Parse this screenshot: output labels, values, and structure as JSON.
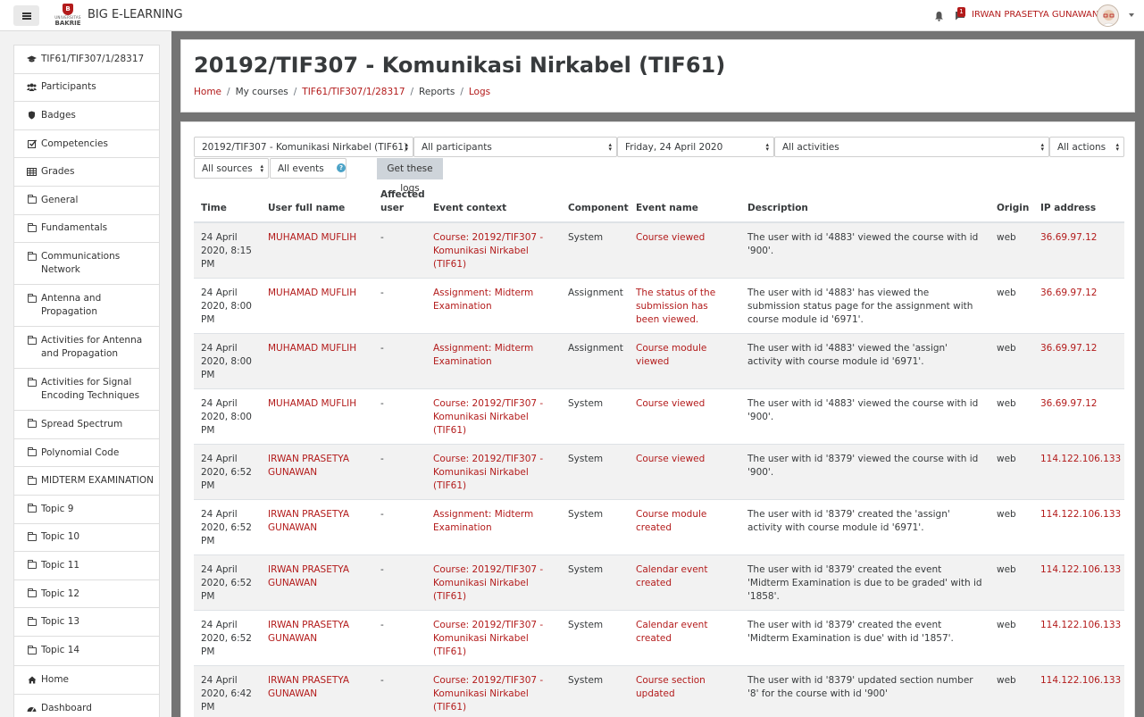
{
  "navbar": {
    "site_name": "BIG E-LEARNING",
    "logo_top": "UNIVERSITAS",
    "logo_bottom": "BAKRIE",
    "logo_mark": "B",
    "user_name": "IRWAN PRASETYA GUNAWAN",
    "message_count": "1"
  },
  "sidebar": {
    "course_items": [
      {
        "label": "TIF61/TIF307/1/28317",
        "icon": "graduation-cap-icon"
      },
      {
        "label": "Participants",
        "icon": "users-icon"
      },
      {
        "label": "Badges",
        "icon": "shield-icon"
      },
      {
        "label": "Competencies",
        "icon": "check-square-icon"
      },
      {
        "label": "Grades",
        "icon": "table-icon"
      },
      {
        "label": "General",
        "icon": "folder-icon"
      },
      {
        "label": "Fundamentals",
        "icon": "folder-icon"
      },
      {
        "label": "Communications Network",
        "icon": "folder-icon"
      },
      {
        "label": "Antenna and Propagation",
        "icon": "folder-icon"
      },
      {
        "label": "Activities for Antenna and Propagation",
        "icon": "folder-icon"
      },
      {
        "label": "Activities for Signal Encoding Techniques",
        "icon": "folder-icon"
      },
      {
        "label": "Spread Spectrum",
        "icon": "folder-icon"
      },
      {
        "label": "Polynomial Code",
        "icon": "folder-icon"
      },
      {
        "label": "MIDTERM EXAMINATION",
        "icon": "folder-icon"
      },
      {
        "label": "Topic 9",
        "icon": "folder-icon"
      },
      {
        "label": "Topic 10",
        "icon": "folder-icon"
      },
      {
        "label": "Topic 11",
        "icon": "folder-icon"
      },
      {
        "label": "Topic 12",
        "icon": "folder-icon"
      },
      {
        "label": "Topic 13",
        "icon": "folder-icon"
      },
      {
        "label": "Topic 14",
        "icon": "folder-icon"
      }
    ],
    "site_items": [
      {
        "label": "Home",
        "icon": "home-icon"
      },
      {
        "label": "Dashboard",
        "icon": "dashboard-icon"
      }
    ]
  },
  "header": {
    "title": "20192/TIF307 - Komunikasi Nirkabel (TIF61)",
    "breadcrumb": [
      "Home",
      "My courses",
      "TIF61/TIF307/1/28317",
      "Reports",
      "Logs"
    ]
  },
  "filters": {
    "course": "20192/TIF307 - Komunikasi Nirkabel (TIF61)",
    "participants": "All participants",
    "date": "Friday, 24 April 2020",
    "activities": "All activities",
    "actions": "All actions",
    "sources": "All sources",
    "events": "All events",
    "help": "?",
    "button": "Get these logs"
  },
  "table": {
    "headers": [
      "Time",
      "User full name",
      "Affected user",
      "Event context",
      "Component",
      "Event name",
      "Description",
      "Origin",
      "IP address"
    ],
    "rows": [
      {
        "time": "24 April 2020, 8:15 PM",
        "user": "MUHAMAD MUFLIH",
        "affected": "-",
        "context": "Course: 20192/TIF307 - Komunikasi Nirkabel (TIF61)",
        "component": "System",
        "event": "Course viewed",
        "description": "The user with id '4883' viewed the course with id '900'.",
        "origin": "web",
        "ip": "36.69.97.12"
      },
      {
        "time": "24 April 2020, 8:00 PM",
        "user": "MUHAMAD MUFLIH",
        "affected": "-",
        "context": "Assignment: Midterm Examination",
        "component": "Assignment",
        "event": "The status of the submission has been viewed.",
        "description": "The user with id '4883' has viewed the submission status page for the assignment with course module id '6971'.",
        "origin": "web",
        "ip": "36.69.97.12"
      },
      {
        "time": "24 April 2020, 8:00 PM",
        "user": "MUHAMAD MUFLIH",
        "affected": "-",
        "context": "Assignment: Midterm Examination",
        "component": "Assignment",
        "event": "Course module viewed",
        "description": "The user with id '4883' viewed the 'assign' activity with course module id '6971'.",
        "origin": "web",
        "ip": "36.69.97.12"
      },
      {
        "time": "24 April 2020, 8:00 PM",
        "user": "MUHAMAD MUFLIH",
        "affected": "-",
        "context": "Course: 20192/TIF307 - Komunikasi Nirkabel (TIF61)",
        "component": "System",
        "event": "Course viewed",
        "description": "The user with id '4883' viewed the course with id '900'.",
        "origin": "web",
        "ip": "36.69.97.12"
      },
      {
        "time": "24 April 2020, 6:52 PM",
        "user": "IRWAN PRASETYA GUNAWAN",
        "affected": "-",
        "context": "Course: 20192/TIF307 - Komunikasi Nirkabel (TIF61)",
        "component": "System",
        "event": "Course viewed",
        "description": "The user with id '8379' viewed the course with id '900'.",
        "origin": "web",
        "ip": "114.122.106.133"
      },
      {
        "time": "24 April 2020, 6:52 PM",
        "user": "IRWAN PRASETYA GUNAWAN",
        "affected": "-",
        "context": "Assignment: Midterm Examination",
        "component": "System",
        "event": "Course module created",
        "description": "The user with id '8379' created the 'assign' activity with course module id '6971'.",
        "origin": "web",
        "ip": "114.122.106.133"
      },
      {
        "time": "24 April 2020, 6:52 PM",
        "user": "IRWAN PRASETYA GUNAWAN",
        "affected": "-",
        "context": "Course: 20192/TIF307 - Komunikasi Nirkabel (TIF61)",
        "component": "System",
        "event": "Calendar event created",
        "description": "The user with id '8379' created the event 'Midterm Examination is due to be graded' with id '1858'.",
        "origin": "web",
        "ip": "114.122.106.133"
      },
      {
        "time": "24 April 2020, 6:52 PM",
        "user": "IRWAN PRASETYA GUNAWAN",
        "affected": "-",
        "context": "Course: 20192/TIF307 - Komunikasi Nirkabel (TIF61)",
        "component": "System",
        "event": "Calendar event created",
        "description": "The user with id '8379' created the event 'Midterm Examination is due' with id '1857'.",
        "origin": "web",
        "ip": "114.122.106.133"
      },
      {
        "time": "24 April 2020, 6:42 PM",
        "user": "IRWAN PRASETYA GUNAWAN",
        "affected": "-",
        "context": "Course: 20192/TIF307 - Komunikasi Nirkabel (TIF61)",
        "component": "System",
        "event": "Course section updated",
        "description": "The user with id '8379' updated section number '8' for the course with id '900'",
        "origin": "web",
        "ip": "114.122.106.133"
      }
    ]
  }
}
